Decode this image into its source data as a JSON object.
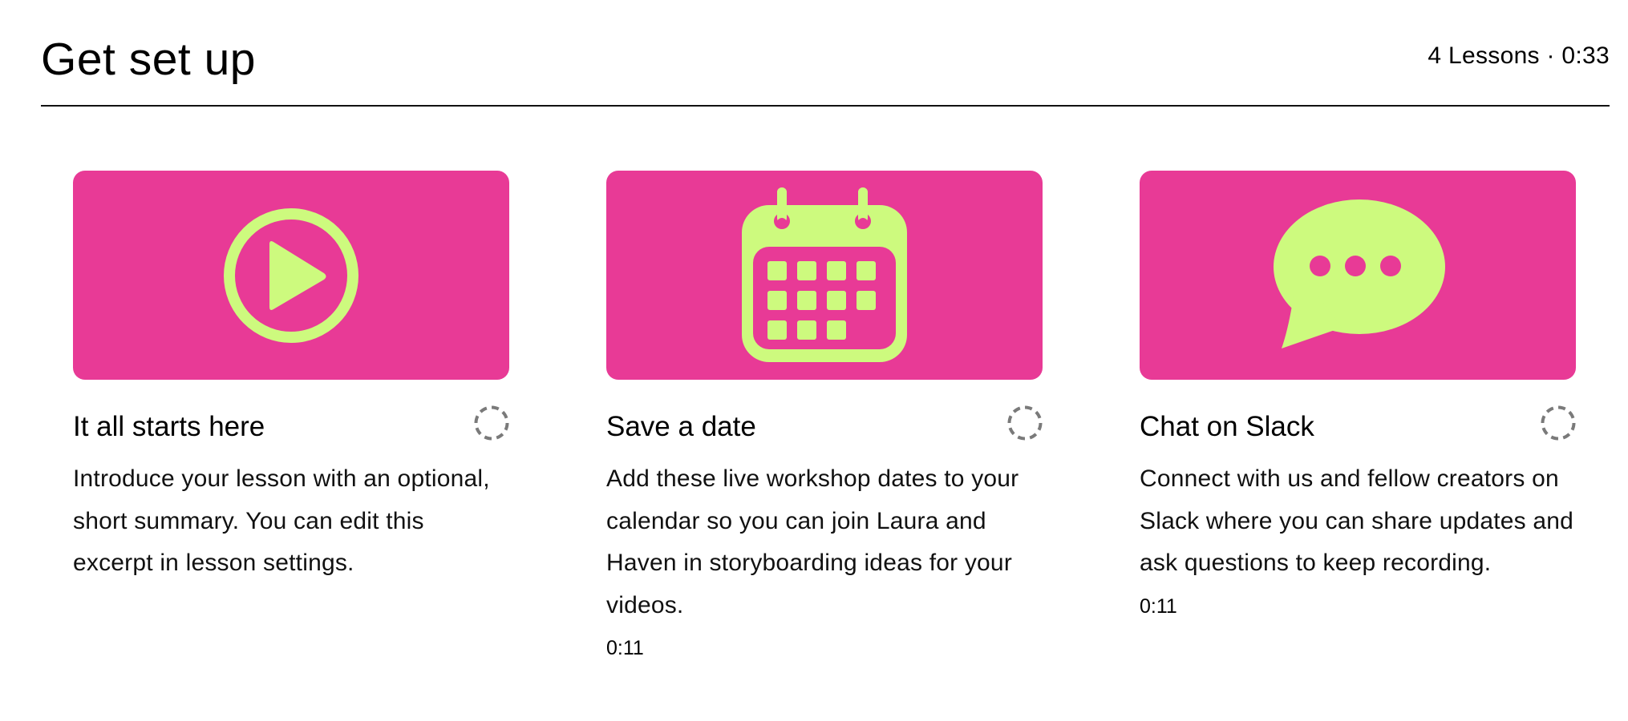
{
  "section": {
    "title": "Get set up",
    "meta": "4 Lessons · 0:33"
  },
  "colors": {
    "thumbnail_bg": "#E83A96",
    "icon_fill": "#CDFA7E",
    "status_ring": "#7A7A7A",
    "divider": "#111111"
  },
  "lessons": [
    {
      "title": "It all starts here",
      "description": "Introduce your lesson with an optional, short summary. You can edit this excerpt in lesson settings.",
      "duration": "",
      "icon": "play-circle-icon",
      "status": "not-started"
    },
    {
      "title": "Save a date",
      "description": "Add these live workshop dates to your calendar so you can join Laura and Haven in storyboarding ideas for your videos.",
      "duration": "0:11",
      "icon": "calendar-icon",
      "status": "not-started"
    },
    {
      "title": "Chat on Slack",
      "description": "Connect with us and fellow creators on Slack where you can share updates and ask questions to keep recording.",
      "duration": "0:11",
      "icon": "chat-bubble-icon",
      "status": "not-started"
    }
  ]
}
